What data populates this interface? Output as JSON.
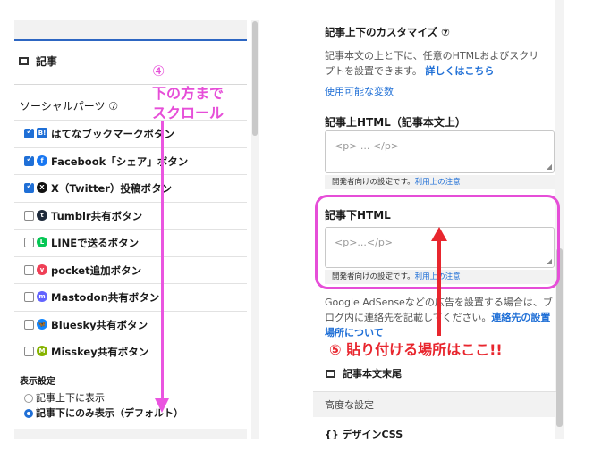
{
  "left": {
    "section_label": "記事",
    "social_title": "ソーシャルパーツ ⑦",
    "social_items": [
      {
        "label": "はてなブックマークボタン",
        "checked": true,
        "icon": "hatena-icon",
        "icon_text": "B!",
        "icon_color": "#1f6fd6"
      },
      {
        "label": "Facebook「シェア」ボタン",
        "checked": true,
        "icon": "facebook-icon",
        "icon_text": "f",
        "icon_color": "#1877f2"
      },
      {
        "label": "X（Twitter）投稿ボタン",
        "checked": true,
        "icon": "x-icon",
        "icon_text": "X",
        "icon_color": "#111111"
      },
      {
        "label": "Tumblr共有ボタン",
        "checked": false,
        "icon": "tumblr-icon",
        "icon_text": "t",
        "icon_color": "#1e2a3a"
      },
      {
        "label": "LINEで送るボタン",
        "checked": false,
        "icon": "line-icon",
        "icon_text": "L",
        "icon_color": "#06c755"
      },
      {
        "label": "pocket追加ボタン",
        "checked": false,
        "icon": "pocket-icon",
        "icon_text": "v",
        "icon_color": "#ef3f56"
      },
      {
        "label": "Mastodon共有ボタン",
        "checked": false,
        "icon": "mastodon-icon",
        "icon_text": "m",
        "icon_color": "#6364ff"
      },
      {
        "label": "Bluesky共有ボタン",
        "checked": false,
        "icon": "bluesky-icon",
        "icon_text": "🦋",
        "icon_color": "#1185fe"
      },
      {
        "label": "Misskey共有ボタン",
        "checked": false,
        "icon": "misskey-icon",
        "icon_text": "M",
        "icon_color": "#86b300"
      }
    ],
    "display_label": "表示設定",
    "radio_option_1": "記事上下に表示",
    "radio_option_2": "記事下にのみ表示（デフォルト）",
    "selected_radio": 2
  },
  "annotation_left": {
    "number": "④",
    "text": "下の方まで\nスクロール",
    "color": "#e64ed8"
  },
  "right": {
    "custom_title": "記事上下のカスタマイズ ⑦",
    "custom_desc": "記事本文の上と下に、任意のHTMLおよびスクリプトを設置できます。",
    "custom_link": "詳しくはこちら",
    "vars_link": "使用可能な変数",
    "upper_label": "記事上HTML（記事本文上）",
    "upper_placeholder": "<p> ... </p>",
    "dev_note": "開発者向けの設定です。",
    "dev_note_link": "利用上の注意",
    "lower_label": "記事下HTML",
    "lower_placeholder": "<p>...</p>",
    "adsense_text": "Google AdSenseなどの広告を設置する場合は、ブログ内に連絡先を記載してください。",
    "adsense_link": "連絡先の設置場所について",
    "tail_label": "記事本文末尾",
    "advanced_label": "高度な設定",
    "design_label": "{} デザインCSS"
  },
  "annotation_right": {
    "text": "⑤ 貼り付ける場所はここ!!",
    "color": "#e8262e",
    "highlight_color": "#e64ed8"
  }
}
